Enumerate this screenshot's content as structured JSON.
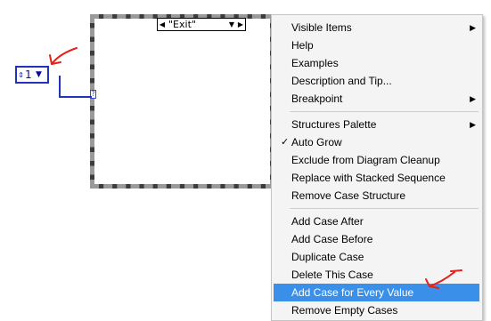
{
  "case_structure": {
    "selector_value": "\"Exit\"",
    "prev_arrow": "◀",
    "next_arrow": "▶",
    "dropdown_arrow": "▼",
    "selector_terminal": "?"
  },
  "ring_constant": {
    "incdec": "⇕",
    "value": "1",
    "dropdown": "▼"
  },
  "context_menu": {
    "items": [
      {
        "label": "Visible Items",
        "submenu": true
      },
      {
        "label": "Help"
      },
      {
        "label": "Examples"
      },
      {
        "label": "Description and Tip..."
      },
      {
        "label": "Breakpoint",
        "submenu": true
      },
      {
        "label": "Structures Palette",
        "submenu": true
      },
      {
        "label": "Auto Grow",
        "checked": true
      },
      {
        "label": "Exclude from Diagram Cleanup"
      },
      {
        "label": "Replace with Stacked Sequence"
      },
      {
        "label": "Remove Case Structure"
      },
      {
        "label": "Add Case After"
      },
      {
        "label": "Add Case Before"
      },
      {
        "label": "Duplicate Case"
      },
      {
        "label": "Delete This Case"
      },
      {
        "label": "Add Case for Every Value",
        "selected": true
      },
      {
        "label": "Remove Empty Cases"
      }
    ],
    "check_glyph": "✓",
    "submenu_glyph": "▶",
    "highlight_color": "#3a8fe8"
  },
  "annotations": {
    "color": "#e8201a"
  }
}
